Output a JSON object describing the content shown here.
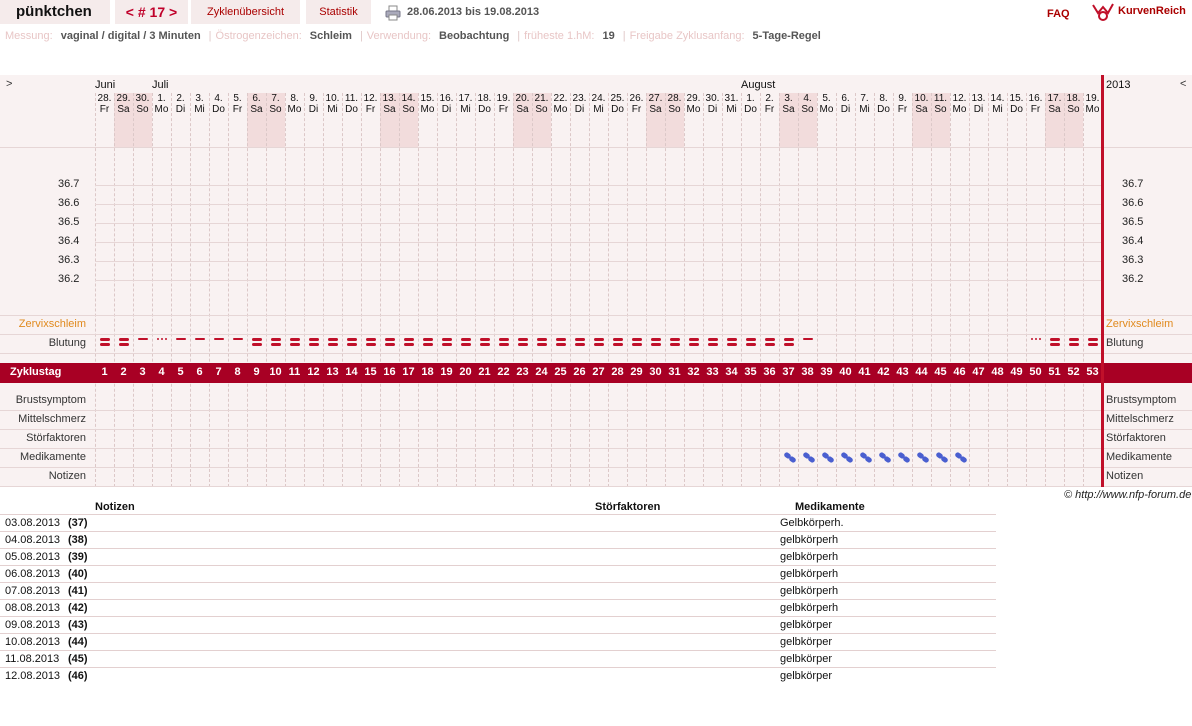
{
  "header": {
    "brand": "pünktchen",
    "cycle_nav": "< # 17 >",
    "tab_overview": "Zyklenübersicht",
    "tab_stats": "Statistik",
    "date_range": "28.06.2013 bis 19.08.2013",
    "faq": "FAQ",
    "logo_text": "KurvenReich",
    "printer_icon": "printer-icon"
  },
  "info": [
    {
      "label": "Messung:",
      "value": "vaginal / digital / 3 Minuten"
    },
    {
      "label": "Östrogenzeichen:",
      "value": "Schleim"
    },
    {
      "label": "Verwendung:",
      "value": "Beobachtung"
    },
    {
      "label": "früheste 1.hM:",
      "value": "19"
    },
    {
      "label": "Freigabe Zyklusanfang:",
      "value": "5-Tage-Regel"
    }
  ],
  "chart": {
    "nav_prev": ">",
    "nav_next": "<",
    "year": "2013",
    "months": [
      {
        "label": "Juni",
        "day_index": 0
      },
      {
        "label": "Juli",
        "day_index": 3
      },
      {
        "label": "August",
        "day_index": 34
      }
    ],
    "days": [
      {
        "d": "28.",
        "w": "Fr"
      },
      {
        "d": "29.",
        "w": "Sa"
      },
      {
        "d": "30.",
        "w": "So"
      },
      {
        "d": "1.",
        "w": "Mo"
      },
      {
        "d": "2.",
        "w": "Di"
      },
      {
        "d": "3.",
        "w": "Mi"
      },
      {
        "d": "4.",
        "w": "Do"
      },
      {
        "d": "5.",
        "w": "Fr"
      },
      {
        "d": "6.",
        "w": "Sa"
      },
      {
        "d": "7.",
        "w": "So"
      },
      {
        "d": "8.",
        "w": "Mo"
      },
      {
        "d": "9.",
        "w": "Di"
      },
      {
        "d": "10.",
        "w": "Mi"
      },
      {
        "d": "11.",
        "w": "Do"
      },
      {
        "d": "12.",
        "w": "Fr"
      },
      {
        "d": "13.",
        "w": "Sa"
      },
      {
        "d": "14.",
        "w": "So"
      },
      {
        "d": "15.",
        "w": "Mo"
      },
      {
        "d": "16.",
        "w": "Di"
      },
      {
        "d": "17.",
        "w": "Mi"
      },
      {
        "d": "18.",
        "w": "Do"
      },
      {
        "d": "19.",
        "w": "Fr"
      },
      {
        "d": "20.",
        "w": "Sa"
      },
      {
        "d": "21.",
        "w": "So"
      },
      {
        "d": "22.",
        "w": "Mo"
      },
      {
        "d": "23.",
        "w": "Di"
      },
      {
        "d": "24.",
        "w": "Mi"
      },
      {
        "d": "25.",
        "w": "Do"
      },
      {
        "d": "26.",
        "w": "Fr"
      },
      {
        "d": "27.",
        "w": "Sa"
      },
      {
        "d": "28.",
        "w": "So"
      },
      {
        "d": "29.",
        "w": "Mo"
      },
      {
        "d": "30.",
        "w": "Di"
      },
      {
        "d": "31.",
        "w": "Mi"
      },
      {
        "d": "1.",
        "w": "Do"
      },
      {
        "d": "2.",
        "w": "Fr"
      },
      {
        "d": "3.",
        "w": "Sa"
      },
      {
        "d": "4.",
        "w": "So"
      },
      {
        "d": "5.",
        "w": "Mo"
      },
      {
        "d": "6.",
        "w": "Di"
      },
      {
        "d": "7.",
        "w": "Mi"
      },
      {
        "d": "8.",
        "w": "Do"
      },
      {
        "d": "9.",
        "w": "Fr"
      },
      {
        "d": "10.",
        "w": "Sa"
      },
      {
        "d": "11.",
        "w": "So"
      },
      {
        "d": "12.",
        "w": "Mo"
      },
      {
        "d": "13.",
        "w": "Di"
      },
      {
        "d": "14.",
        "w": "Mi"
      },
      {
        "d": "15.",
        "w": "Do"
      },
      {
        "d": "16.",
        "w": "Fr"
      },
      {
        "d": "17.",
        "w": "Sa"
      },
      {
        "d": "18.",
        "w": "So"
      },
      {
        "d": "19.",
        "w": "Mo"
      }
    ],
    "temp_ticks": [
      "36.7",
      "36.6",
      "36.5",
      "36.4",
      "36.3",
      "36.2"
    ],
    "rows": {
      "zervix": "Zervixschleim",
      "blutung": "Blutung",
      "zyklustag": "Zyklustag",
      "brust": "Brustsymptom",
      "mittel": "Mittelschmerz",
      "stoer": "Störfaktoren",
      "medik": "Medikamente",
      "notizen": "Notizen"
    },
    "bleeding": [
      3,
      3,
      1,
      2,
      1,
      1,
      1,
      1,
      3,
      3,
      3,
      3,
      3,
      3,
      3,
      3,
      3,
      3,
      3,
      3,
      3,
      3,
      3,
      3,
      3,
      3,
      3,
      3,
      3,
      3,
      3,
      3,
      3,
      3,
      3,
      3,
      3,
      1,
      0,
      0,
      0,
      0,
      0,
      0,
      0,
      0,
      0,
      0,
      0,
      2,
      3,
      3,
      3
    ],
    "medication_days": [
      37,
      38,
      39,
      40,
      41,
      42,
      43,
      44,
      45,
      46
    ],
    "colors": {
      "accent": "#a80024",
      "bleed": "#c0102a",
      "med": "#4a5fd0",
      "orange": "#e08a1e"
    }
  },
  "notes_table": {
    "copyright": "© http://www.nfp-forum.de",
    "headers": {
      "notizen": "Notizen",
      "stoer": "Störfaktoren",
      "medik": "Medikamente"
    },
    "rows": [
      {
        "date": "03.08.2013",
        "day": "(37)",
        "med": "Gelbkörperh."
      },
      {
        "date": "04.08.2013",
        "day": "(38)",
        "med": "gelbkörperh"
      },
      {
        "date": "05.08.2013",
        "day": "(39)",
        "med": "gelbkörperh"
      },
      {
        "date": "06.08.2013",
        "day": "(40)",
        "med": "gelbkörperh"
      },
      {
        "date": "07.08.2013",
        "day": "(41)",
        "med": "gelbkörperh"
      },
      {
        "date": "08.08.2013",
        "day": "(42)",
        "med": "gelbkörperh"
      },
      {
        "date": "09.08.2013",
        "day": "(43)",
        "med": "gelbkörper"
      },
      {
        "date": "10.08.2013",
        "day": "(44)",
        "med": "gelbkörper"
      },
      {
        "date": "11.08.2013",
        "day": "(45)",
        "med": "gelbkörper"
      },
      {
        "date": "12.08.2013",
        "day": "(46)",
        "med": "gelbkörper"
      }
    ]
  }
}
